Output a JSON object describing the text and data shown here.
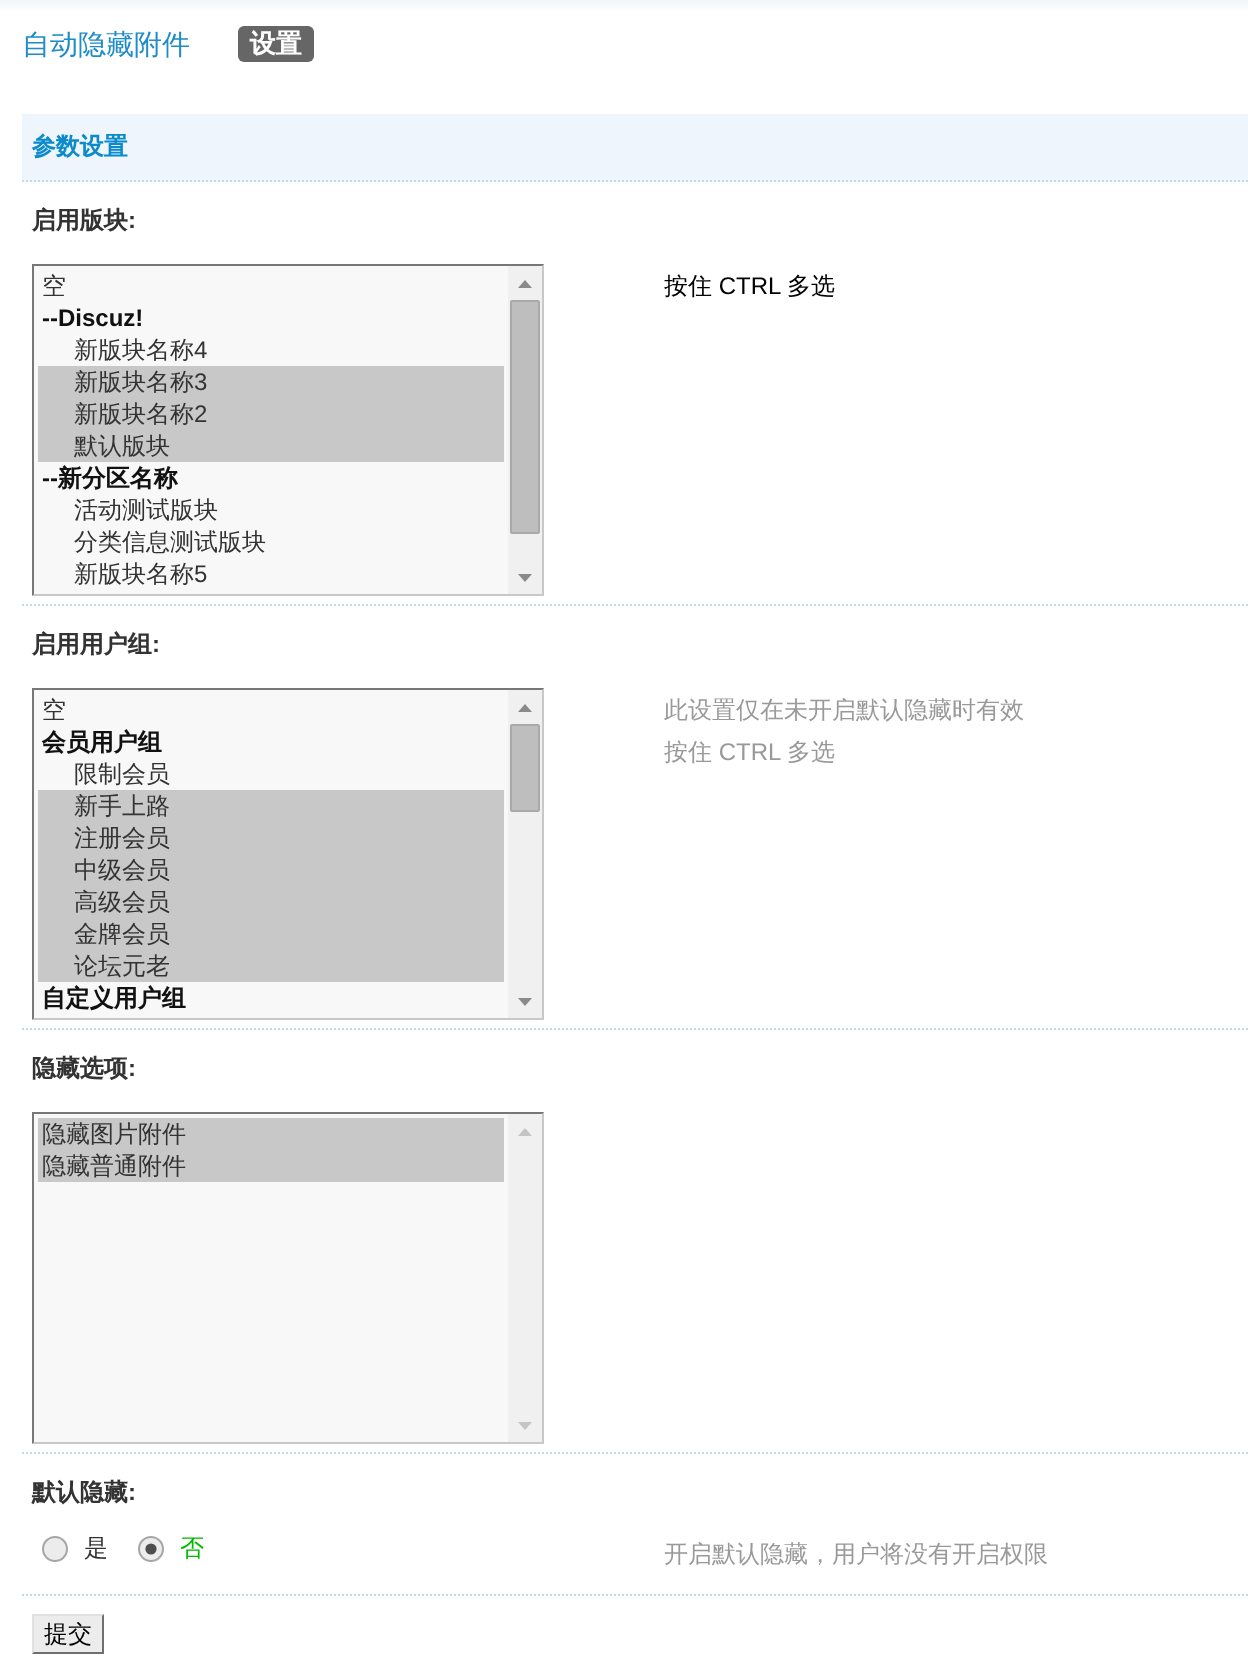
{
  "page": {
    "title": "自动隐藏附件",
    "tabs": [
      {
        "label": "设置",
        "selected": true
      }
    ]
  },
  "section": {
    "title": "参数设置"
  },
  "fields": [
    {
      "kind": "listbox",
      "label": "启用版块:",
      "hovered": true,
      "hint_lines": [
        "按住 CTRL 多选"
      ],
      "options": [
        {
          "kind": "option",
          "label": "空",
          "selected": false
        },
        {
          "kind": "group",
          "label": "--Discuz!",
          "children": [
            {
              "kind": "option",
              "label": "新版块名称4",
              "selected": false
            },
            {
              "kind": "option",
              "label": "新版块名称3",
              "selected": true
            },
            {
              "kind": "option",
              "label": "新版块名称2",
              "selected": true
            },
            {
              "kind": "option",
              "label": "默认版块",
              "selected": true
            }
          ]
        },
        {
          "kind": "group",
          "label": "--新分区名称",
          "children": [
            {
              "kind": "option",
              "label": "活动测试版块",
              "selected": false
            },
            {
              "kind": "option",
              "label": "分类信息测试版块",
              "selected": false
            },
            {
              "kind": "option",
              "label": "新版块名称5",
              "selected": false
            }
          ]
        }
      ]
    },
    {
      "kind": "listbox",
      "label": "启用用户组:",
      "hovered": false,
      "hint_lines": [
        "此设置仅在未开启默认隐藏时有效",
        "按住 CTRL 多选"
      ],
      "options": [
        {
          "kind": "option",
          "label": "空",
          "selected": false
        },
        {
          "kind": "group",
          "label": "会员用户组",
          "children": [
            {
              "kind": "option",
              "label": "限制会员",
              "selected": false
            },
            {
              "kind": "option",
              "label": "新手上路",
              "selected": true
            },
            {
              "kind": "option",
              "label": "注册会员",
              "selected": true
            },
            {
              "kind": "option",
              "label": "中级会员",
              "selected": true
            },
            {
              "kind": "option",
              "label": "高级会员",
              "selected": true
            },
            {
              "kind": "option",
              "label": "金牌会员",
              "selected": true
            },
            {
              "kind": "option",
              "label": "论坛元老",
              "selected": true
            }
          ]
        },
        {
          "kind": "group",
          "label": "自定义用户组"
        }
      ]
    },
    {
      "kind": "listbox",
      "label": "隐藏选项:",
      "options": [
        {
          "kind": "option",
          "label": "隐藏图片附件",
          "selected": true
        },
        {
          "kind": "option",
          "label": "隐藏普通附件",
          "selected": true
        }
      ]
    },
    {
      "kind": "radio",
      "label": "默认隐藏:",
      "hovered": false,
      "hint_lines": [
        "开启默认隐藏，用户将没有开启权限"
      ],
      "options": [
        {
          "label": "是",
          "selected": false
        },
        {
          "label": "否",
          "selected": true
        }
      ]
    }
  ],
  "submit_button": "提交"
}
